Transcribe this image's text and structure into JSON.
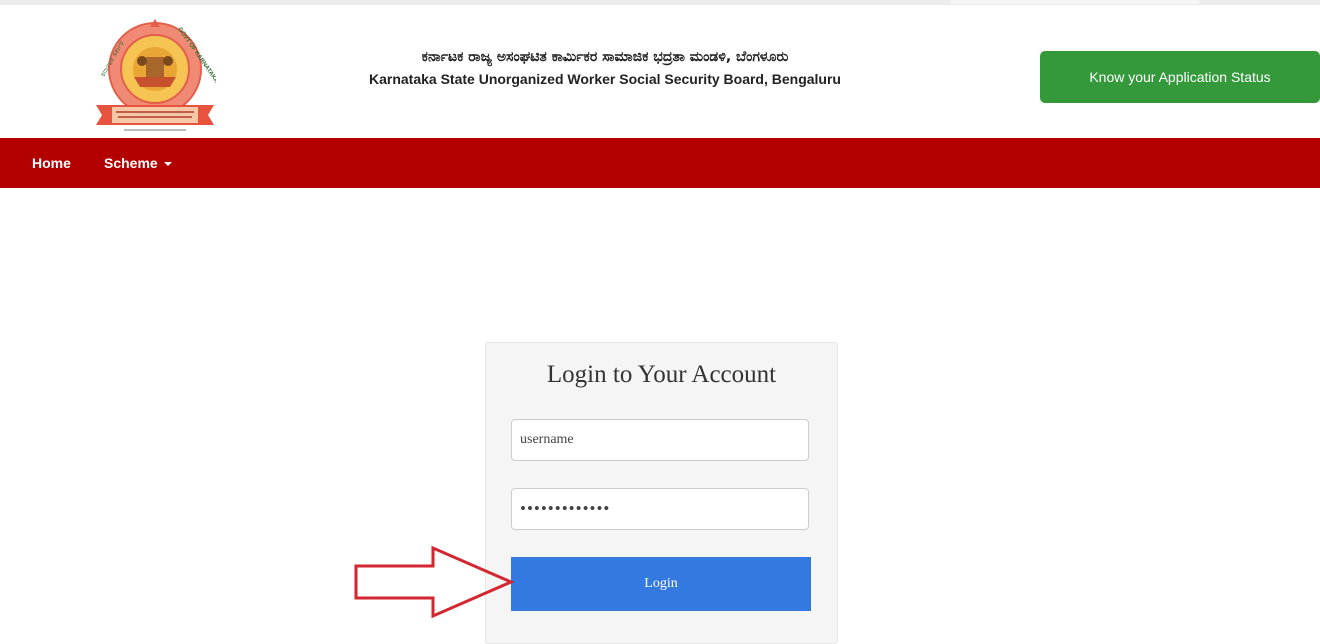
{
  "header": {
    "title_kannada": "ಕರ್ನಾಟಕ ರಾಜ್ಯ ಅಸಂಘಟಿತ ಕಾರ್ಮಿಕರ ಸಾಮಾಜಿಕ ಭದ್ರತಾ ಮಂಡಳಿ, ಬೆಂಗಳೂರು",
    "title_english": "Karnataka State Unorganized Worker Social Security Board, Bengaluru",
    "status_button_label": "Know your Application Status",
    "logo": {
      "text_top_left": "ಕರ್ನಾಟಕ ಸರ್ಕಾರ",
      "text_top_right": "GOVT OF KARNATAKA",
      "banner_line1": "KARNATAKA STATE UNORGANISED WORKERS",
      "banner_line2": "SOCIAL SECURITY BOARD, BENGALURU"
    }
  },
  "nav": {
    "items": [
      {
        "label": "Home"
      },
      {
        "label": "Scheme"
      }
    ]
  },
  "login": {
    "title": "Login to Your Account",
    "username_value": "username",
    "password_value": "•••••••••••••",
    "button_label": "Login"
  },
  "colors": {
    "nav_bg": "#b30000",
    "status_button": "#33993a",
    "login_button": "#3479e0",
    "arrow": "#d22630"
  }
}
